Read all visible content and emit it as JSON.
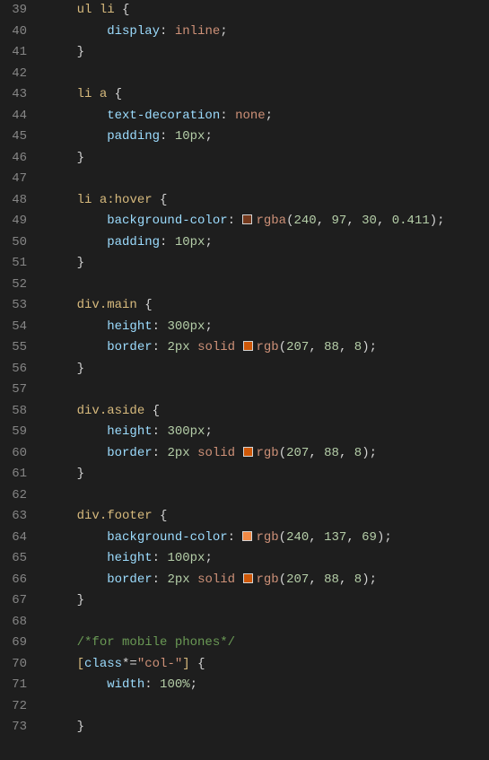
{
  "startLine": 39,
  "lines": [
    {
      "indent": 1,
      "tokens": [
        {
          "t": "ul ",
          "c": "sel"
        },
        {
          "t": "li ",
          "c": "sel"
        },
        {
          "t": "{",
          "c": "brace"
        }
      ]
    },
    {
      "indent": 2,
      "tokens": [
        {
          "t": "display",
          "c": "prop"
        },
        {
          "t": ": ",
          "c": "colon"
        },
        {
          "t": "inline",
          "c": "val"
        },
        {
          "t": ";",
          "c": "punc"
        }
      ]
    },
    {
      "indent": 1,
      "tokens": [
        {
          "t": "}",
          "c": "brace"
        }
      ]
    },
    {
      "indent": 0,
      "tokens": []
    },
    {
      "indent": 1,
      "tokens": [
        {
          "t": "li ",
          "c": "sel"
        },
        {
          "t": "a ",
          "c": "sel"
        },
        {
          "t": "{",
          "c": "brace"
        }
      ]
    },
    {
      "indent": 2,
      "tokens": [
        {
          "t": "text-decoration",
          "c": "prop"
        },
        {
          "t": ": ",
          "c": "colon"
        },
        {
          "t": "none",
          "c": "val"
        },
        {
          "t": ";",
          "c": "punc"
        }
      ]
    },
    {
      "indent": 2,
      "tokens": [
        {
          "t": "padding",
          "c": "prop"
        },
        {
          "t": ": ",
          "c": "colon"
        },
        {
          "t": "10px",
          "c": "num"
        },
        {
          "t": ";",
          "c": "punc"
        }
      ]
    },
    {
      "indent": 1,
      "tokens": [
        {
          "t": "}",
          "c": "brace"
        }
      ]
    },
    {
      "indent": 0,
      "tokens": []
    },
    {
      "indent": 1,
      "tokens": [
        {
          "t": "li ",
          "c": "sel"
        },
        {
          "t": "a",
          "c": "sel"
        },
        {
          "t": ":hover ",
          "c": "sel"
        },
        {
          "t": "{",
          "c": "brace"
        }
      ]
    },
    {
      "indent": 2,
      "tokens": [
        {
          "t": "background-color",
          "c": "prop"
        },
        {
          "t": ": ",
          "c": "colon"
        },
        {
          "swatch": "rgba(240,97,30,0.411)"
        },
        {
          "t": "rgba",
          "c": "func"
        },
        {
          "t": "(",
          "c": "punc"
        },
        {
          "t": "240",
          "c": "num"
        },
        {
          "t": ", ",
          "c": "punc"
        },
        {
          "t": "97",
          "c": "num"
        },
        {
          "t": ", ",
          "c": "punc"
        },
        {
          "t": "30",
          "c": "num"
        },
        {
          "t": ", ",
          "c": "punc"
        },
        {
          "t": "0.411",
          "c": "num"
        },
        {
          "t": ")",
          "c": "punc"
        },
        {
          "t": ";",
          "c": "punc"
        }
      ]
    },
    {
      "indent": 2,
      "tokens": [
        {
          "t": "padding",
          "c": "prop"
        },
        {
          "t": ": ",
          "c": "colon"
        },
        {
          "t": "10px",
          "c": "num"
        },
        {
          "t": ";",
          "c": "punc"
        }
      ]
    },
    {
      "indent": 1,
      "tokens": [
        {
          "t": "}",
          "c": "brace"
        }
      ]
    },
    {
      "indent": 0,
      "tokens": []
    },
    {
      "indent": 1,
      "tokens": [
        {
          "t": "div",
          "c": "sel"
        },
        {
          "t": ".main ",
          "c": "sel"
        },
        {
          "t": "{",
          "c": "brace"
        }
      ]
    },
    {
      "indent": 2,
      "tokens": [
        {
          "t": "height",
          "c": "prop"
        },
        {
          "t": ": ",
          "c": "colon"
        },
        {
          "t": "300px",
          "c": "num"
        },
        {
          "t": ";",
          "c": "punc"
        }
      ]
    },
    {
      "indent": 2,
      "tokens": [
        {
          "t": "border",
          "c": "prop"
        },
        {
          "t": ": ",
          "c": "colon"
        },
        {
          "t": "2px",
          "c": "num"
        },
        {
          "t": " ",
          "c": "punc"
        },
        {
          "t": "solid",
          "c": "val"
        },
        {
          "t": " ",
          "c": "punc"
        },
        {
          "swatch": "rgb(207,88,8)"
        },
        {
          "t": "rgb",
          "c": "func"
        },
        {
          "t": "(",
          "c": "punc"
        },
        {
          "t": "207",
          "c": "num"
        },
        {
          "t": ", ",
          "c": "punc"
        },
        {
          "t": "88",
          "c": "num"
        },
        {
          "t": ", ",
          "c": "punc"
        },
        {
          "t": "8",
          "c": "num"
        },
        {
          "t": ")",
          "c": "punc"
        },
        {
          "t": ";",
          "c": "punc"
        }
      ]
    },
    {
      "indent": 1,
      "tokens": [
        {
          "t": "}",
          "c": "brace"
        }
      ]
    },
    {
      "indent": 0,
      "tokens": []
    },
    {
      "indent": 1,
      "tokens": [
        {
          "t": "div",
          "c": "sel"
        },
        {
          "t": ".aside ",
          "c": "sel"
        },
        {
          "t": "{",
          "c": "brace"
        }
      ]
    },
    {
      "indent": 2,
      "tokens": [
        {
          "t": "height",
          "c": "prop"
        },
        {
          "t": ": ",
          "c": "colon"
        },
        {
          "t": "300px",
          "c": "num"
        },
        {
          "t": ";",
          "c": "punc"
        }
      ]
    },
    {
      "indent": 2,
      "tokens": [
        {
          "t": "border",
          "c": "prop"
        },
        {
          "t": ": ",
          "c": "colon"
        },
        {
          "t": "2px",
          "c": "num"
        },
        {
          "t": " ",
          "c": "punc"
        },
        {
          "t": "solid",
          "c": "val"
        },
        {
          "t": " ",
          "c": "punc"
        },
        {
          "swatch": "rgb(207,88,8)"
        },
        {
          "t": "rgb",
          "c": "func"
        },
        {
          "t": "(",
          "c": "punc"
        },
        {
          "t": "207",
          "c": "num"
        },
        {
          "t": ", ",
          "c": "punc"
        },
        {
          "t": "88",
          "c": "num"
        },
        {
          "t": ", ",
          "c": "punc"
        },
        {
          "t": "8",
          "c": "num"
        },
        {
          "t": ")",
          "c": "punc"
        },
        {
          "t": ";",
          "c": "punc"
        }
      ]
    },
    {
      "indent": 1,
      "tokens": [
        {
          "t": "}",
          "c": "brace"
        }
      ]
    },
    {
      "indent": 0,
      "tokens": []
    },
    {
      "indent": 1,
      "tokens": [
        {
          "t": "div",
          "c": "sel"
        },
        {
          "t": ".footer ",
          "c": "sel"
        },
        {
          "t": "{",
          "c": "brace"
        }
      ]
    },
    {
      "indent": 2,
      "tokens": [
        {
          "t": "background-color",
          "c": "prop"
        },
        {
          "t": ": ",
          "c": "colon"
        },
        {
          "swatch": "rgb(240,137,69)"
        },
        {
          "t": "rgb",
          "c": "func"
        },
        {
          "t": "(",
          "c": "punc"
        },
        {
          "t": "240",
          "c": "num"
        },
        {
          "t": ", ",
          "c": "punc"
        },
        {
          "t": "137",
          "c": "num"
        },
        {
          "t": ", ",
          "c": "punc"
        },
        {
          "t": "69",
          "c": "num"
        },
        {
          "t": ")",
          "c": "punc"
        },
        {
          "t": ";",
          "c": "punc"
        }
      ]
    },
    {
      "indent": 2,
      "tokens": [
        {
          "t": "height",
          "c": "prop"
        },
        {
          "t": ": ",
          "c": "colon"
        },
        {
          "t": "100px",
          "c": "num"
        },
        {
          "t": ";",
          "c": "punc"
        }
      ]
    },
    {
      "indent": 2,
      "tokens": [
        {
          "t": "border",
          "c": "prop"
        },
        {
          "t": ": ",
          "c": "colon"
        },
        {
          "t": "2px",
          "c": "num"
        },
        {
          "t": " ",
          "c": "punc"
        },
        {
          "t": "solid",
          "c": "val"
        },
        {
          "t": " ",
          "c": "punc"
        },
        {
          "swatch": "rgb(207,88,8)"
        },
        {
          "t": "rgb",
          "c": "func"
        },
        {
          "t": "(",
          "c": "punc"
        },
        {
          "t": "207",
          "c": "num"
        },
        {
          "t": ", ",
          "c": "punc"
        },
        {
          "t": "88",
          "c": "num"
        },
        {
          "t": ", ",
          "c": "punc"
        },
        {
          "t": "8",
          "c": "num"
        },
        {
          "t": ")",
          "c": "punc"
        },
        {
          "t": ";",
          "c": "punc"
        }
      ]
    },
    {
      "indent": 1,
      "tokens": [
        {
          "t": "}",
          "c": "brace"
        }
      ]
    },
    {
      "indent": 0,
      "tokens": []
    },
    {
      "indent": 1,
      "tokens": [
        {
          "t": "/*for mobile phones*/",
          "c": "comment"
        }
      ]
    },
    {
      "indent": 1,
      "tokens": [
        {
          "t": "[",
          "c": "sel"
        },
        {
          "t": "class",
          "c": "prop"
        },
        {
          "t": "*=",
          "c": "punc"
        },
        {
          "t": "\"col-\"",
          "c": "str"
        },
        {
          "t": "] ",
          "c": "sel"
        },
        {
          "t": "{",
          "c": "brace"
        }
      ]
    },
    {
      "indent": 2,
      "tokens": [
        {
          "t": "width",
          "c": "prop"
        },
        {
          "t": ": ",
          "c": "colon"
        },
        {
          "t": "100%",
          "c": "num"
        },
        {
          "t": ";",
          "c": "punc"
        }
      ]
    },
    {
      "indent": 0,
      "tokens": []
    },
    {
      "indent": 1,
      "tokens": [
        {
          "t": "}",
          "c": "brace"
        }
      ]
    }
  ]
}
